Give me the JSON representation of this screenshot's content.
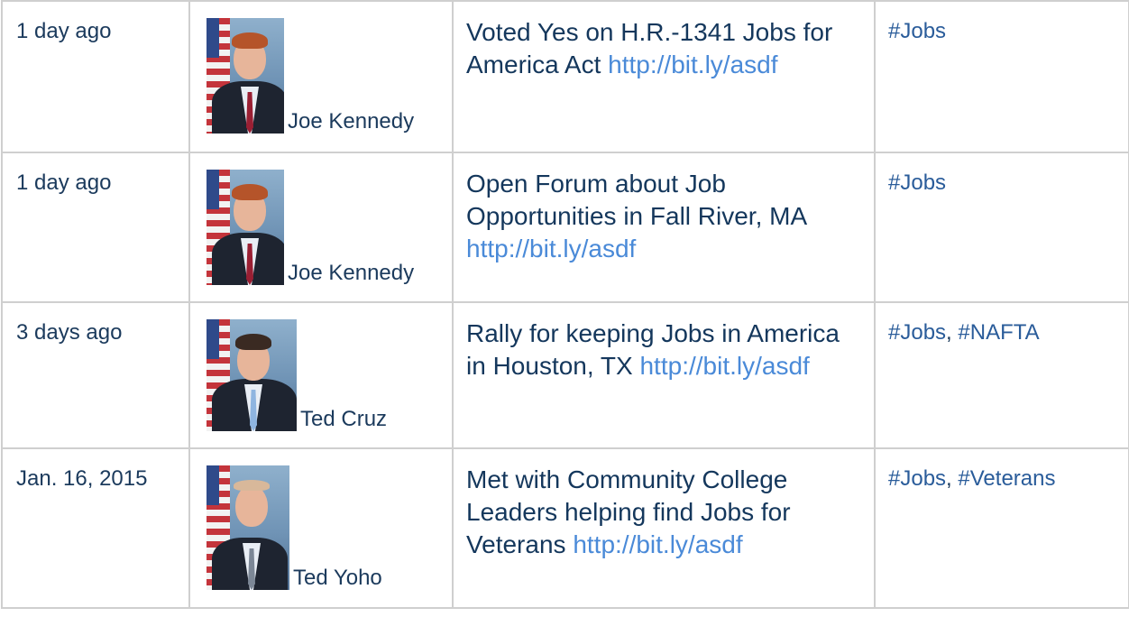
{
  "rows": [
    {
      "date": "1 day ago",
      "person": "Joe Kennedy",
      "post_text": "Voted Yes on H.R.-1341 Jobs for America Act",
      "post_link": "http://bit.ly/asdf",
      "tags": [
        "#Jobs"
      ]
    },
    {
      "date": "1 day ago",
      "person": "Joe Kennedy",
      "post_text": "Open Forum about Job Opportunities in Fall River, MA",
      "post_link": "http://bit.ly/asdf",
      "tags": [
        "#Jobs"
      ]
    },
    {
      "date": "3 days ago",
      "person": "Ted Cruz",
      "post_text": "Rally for keeping Jobs in America in Houston, TX",
      "post_link": "http://bit.ly/asdf",
      "tags": [
        "#Jobs",
        "#NAFTA"
      ]
    },
    {
      "date": "Jan. 16, 2015",
      "person": "Ted Yoho",
      "post_text": "Met with Community College Leaders helping find Jobs for Veterans",
      "post_link": "http://bit.ly/asdf",
      "tags": [
        "#Jobs",
        "#Veterans"
      ]
    }
  ],
  "colors": {
    "text": "#14375c",
    "link": "#4a8ad8",
    "tag": "#2a5c9a",
    "border": "#cfcfcf"
  }
}
